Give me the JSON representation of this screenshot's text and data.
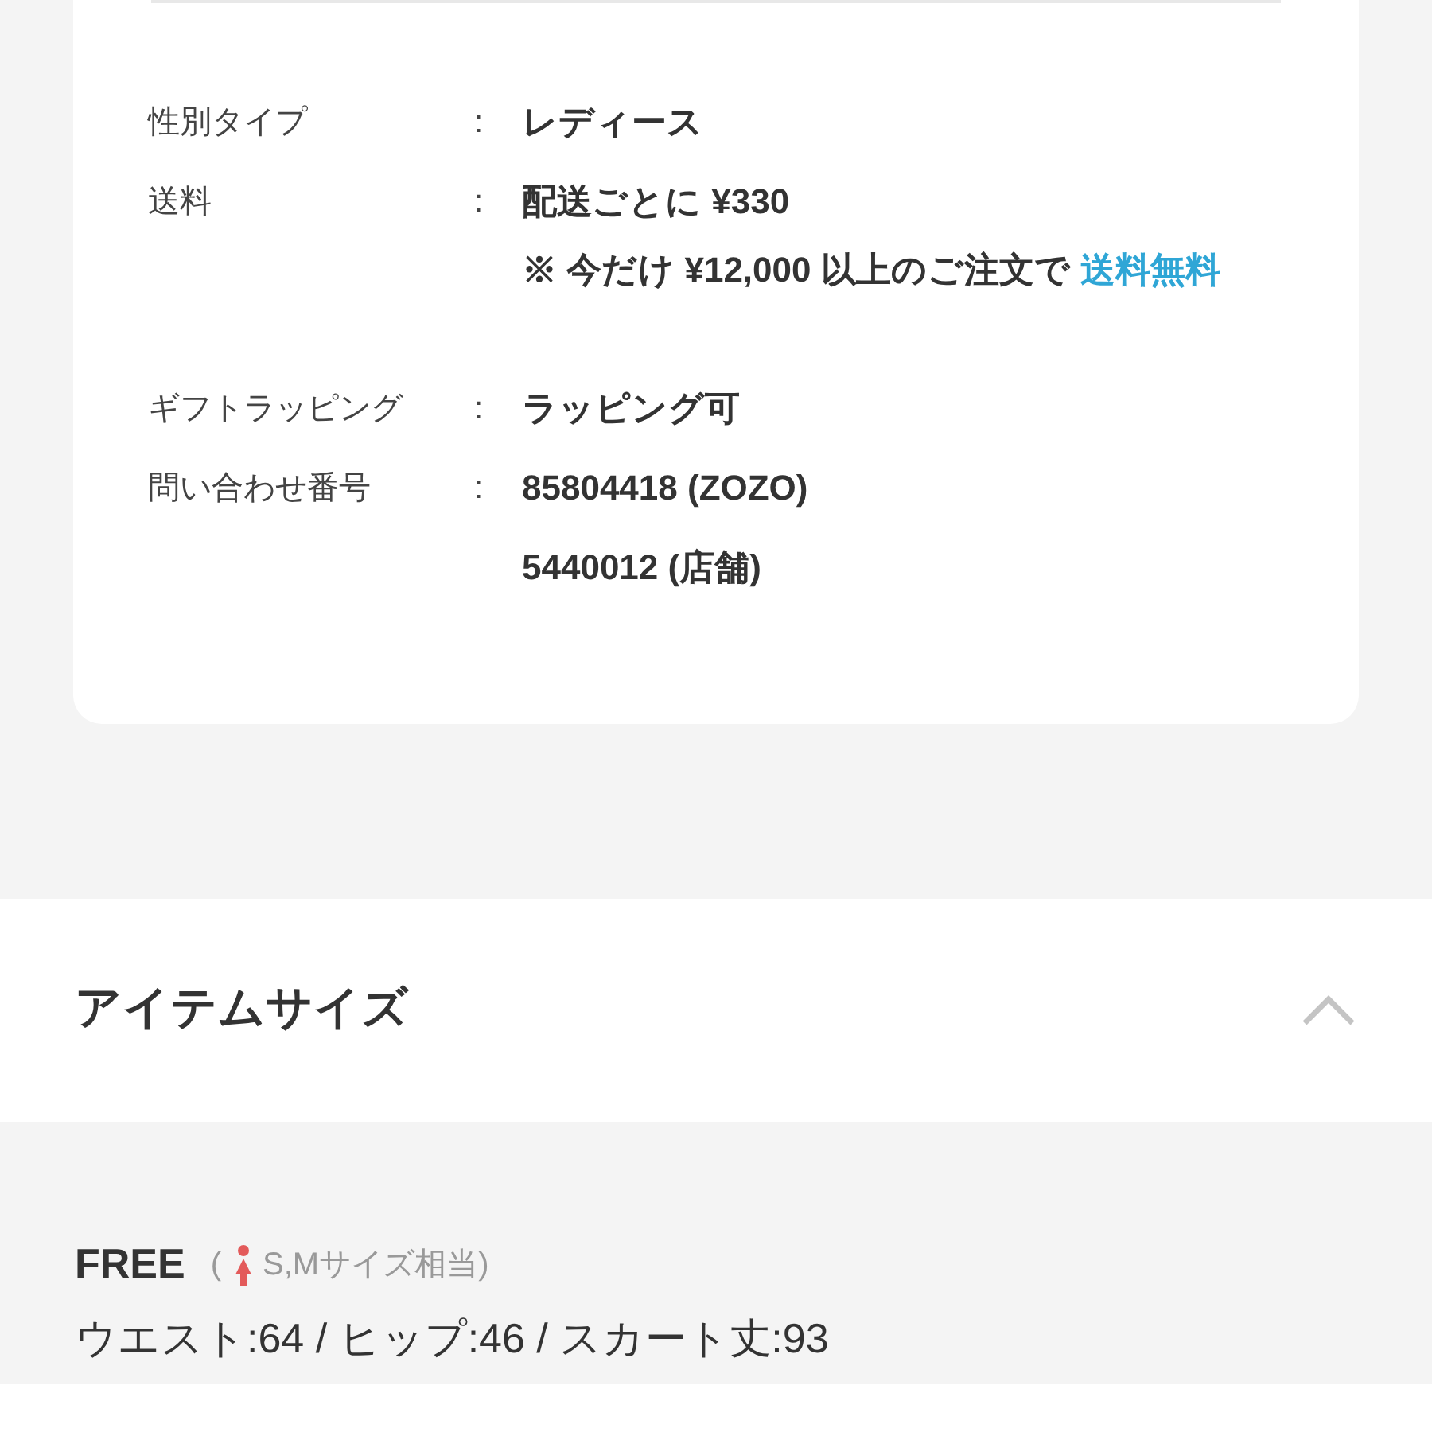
{
  "specs": [
    {
      "label": "性別タイプ",
      "values": [
        "レディース"
      ]
    },
    {
      "label": "送料",
      "values": [
        "配送ごとに ¥330"
      ],
      "note": {
        "text": "※ 今だけ ¥12,000 以上のご注文で",
        "link": "送料無料"
      }
    },
    {
      "label": "ギフトラッピング",
      "values": [
        "ラッピング可"
      ]
    },
    {
      "label": "問い合わせ番号",
      "values": [
        "85804418 (ZOZO)",
        "5440012 (店舗)"
      ]
    }
  ],
  "separator": ":",
  "size_section": {
    "title": "アイテムサイズ",
    "expanded": true,
    "sizes": [
      {
        "name": "FREE",
        "open_paren": "(",
        "equivalent": "S,Mサイズ相当)",
        "measurements": "ウエスト:64 / ヒップ:46 / スカート丈:93"
      }
    ]
  }
}
